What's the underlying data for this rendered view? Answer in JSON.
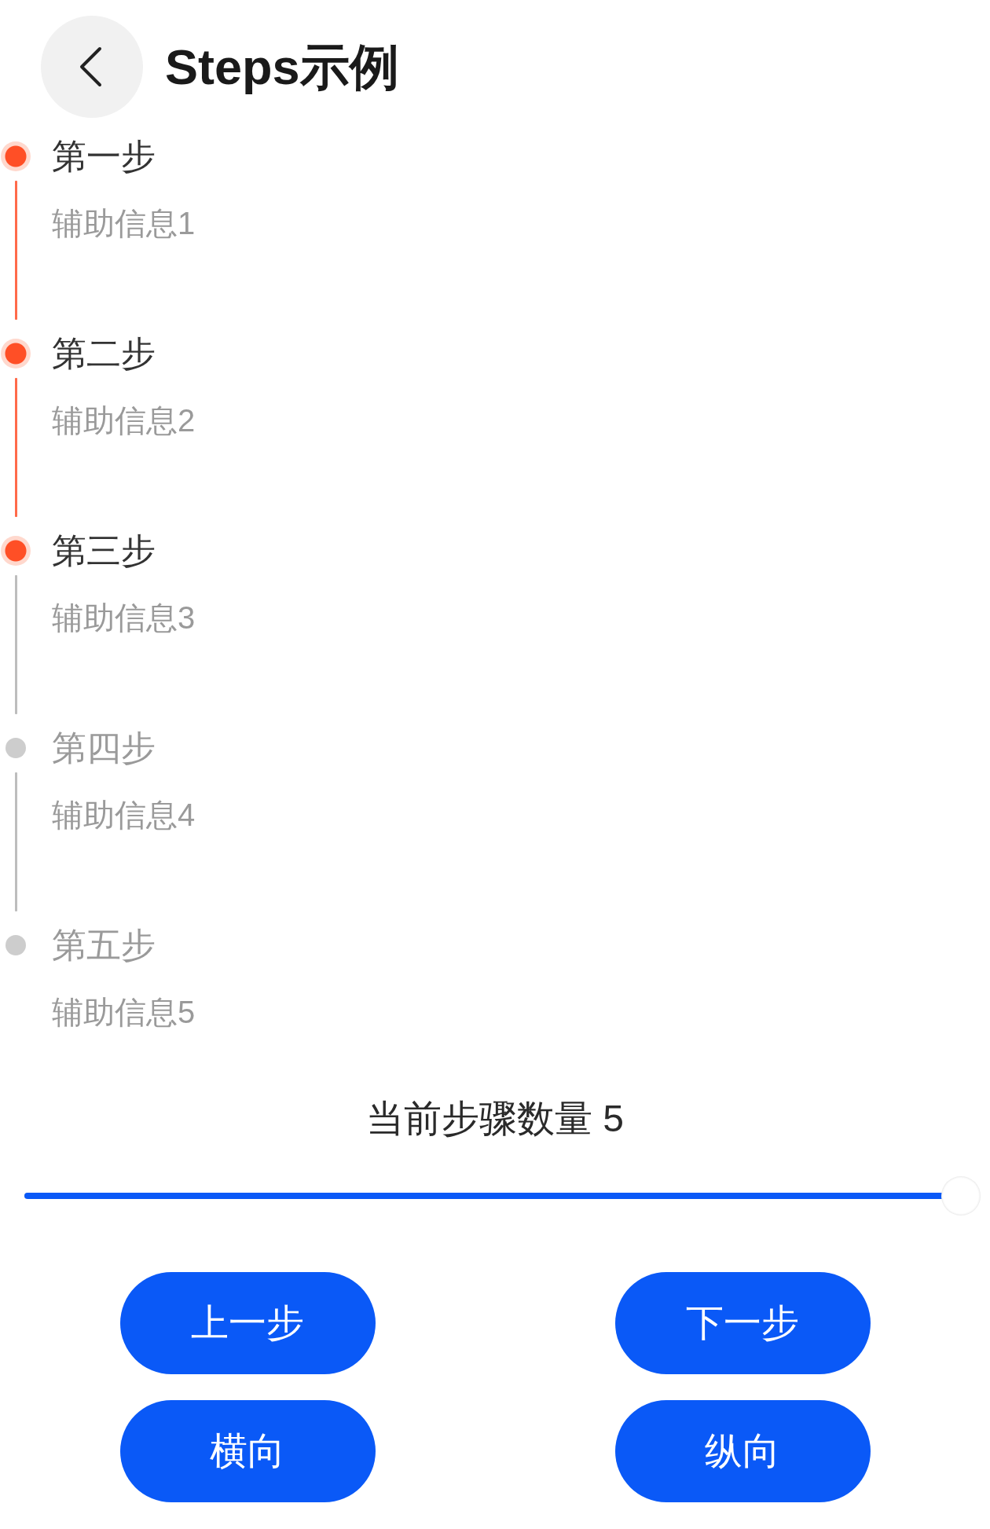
{
  "header": {
    "title": "Steps示例"
  },
  "steps": [
    {
      "title": "第一步",
      "info": "辅助信息1",
      "active": true
    },
    {
      "title": "第二步",
      "info": "辅助信息2",
      "active": true
    },
    {
      "title": "第三步",
      "info": "辅助信息3",
      "active": true
    },
    {
      "title": "第四步",
      "info": "辅助信息4",
      "active": false
    },
    {
      "title": "第五步",
      "info": "辅助信息5",
      "active": false
    }
  ],
  "slider": {
    "label": "当前步骤数量 5",
    "level": 1
  },
  "buttons": [
    "上一步",
    "下一步",
    "横向",
    "纵向"
  ]
}
